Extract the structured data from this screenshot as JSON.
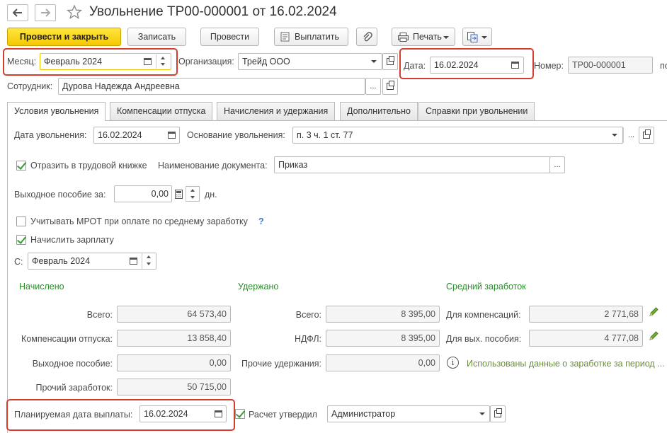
{
  "window": {
    "title": "Увольнение ТР00-000001 от 16.02.2024"
  },
  "toolbar": {
    "post_close": "Провести и закрыть",
    "save": "Записать",
    "post": "Провести",
    "pay": "Выплатить",
    "print": "Печать"
  },
  "header": {
    "month_label": "Месяц:",
    "month_value": "Февраль 2024",
    "org_label": "Организация:",
    "org_value": "Трейд ООО",
    "date_label": "Дата:",
    "date_value": "16.02.2024",
    "number_label": "Номер:",
    "number_value": "ТР00-000001",
    "number_suffix": "по",
    "employee_label": "Сотрудник:",
    "employee_value": "Дурова Надежда Андреевна"
  },
  "tabs": [
    {
      "label": "Условия увольнения"
    },
    {
      "label": "Компенсации отпуска"
    },
    {
      "label": "Начисления и удержания"
    },
    {
      "label": "Дополнительно"
    },
    {
      "label": "Справки при увольнении"
    }
  ],
  "form": {
    "dismissal_date_label": "Дата увольнения:",
    "dismissal_date_value": "16.02.2024",
    "basis_label": "Основание увольнения:",
    "basis_value": "п. 3 ч. 1 ст. 77",
    "workbook_label": "Отразить в трудовой книжке",
    "doc_name_label": "Наименование документа:",
    "doc_name_value": "Приказ",
    "severance_label": "Выходное пособие за:",
    "severance_value": "0,00",
    "severance_unit": "дн.",
    "mrot_label": "Учитывать МРОТ при оплате по среднему заработку",
    "mrot_help": "?",
    "accrue_label": "Начислить зарплату",
    "from_label": "С:",
    "from_value": "Февраль 2024"
  },
  "accrued": {
    "title": "Начислено",
    "total_label": "Всего:",
    "total_value": "64 573,40",
    "vacation_label": "Компенсации отпуска:",
    "vacation_value": "13 858,40",
    "severance_label": "Выходное пособие:",
    "severance_value": "0,00",
    "other_label": "Прочий заработок:",
    "other_value": "50 715,00"
  },
  "withheld": {
    "title": "Удержано",
    "total_label": "Всего:",
    "total_value": "8 395,00",
    "ndfl_label": "НДФЛ:",
    "ndfl_value": "8 395,00",
    "other_label": "Прочие удержания:",
    "other_value": "0,00"
  },
  "average": {
    "title": "Средний заработок",
    "comp_label": "Для компенсаций:",
    "comp_value": "2 771,68",
    "sev_label": "Для вых. пособия:",
    "sev_value": "4 777,08",
    "info_text": "Использованы данные о заработке за период ..."
  },
  "footer": {
    "planned_label": "Планируемая дата выплаты:",
    "planned_value": "16.02.2024",
    "approved_label": "Расчет утвердил",
    "approved_value": "Администратор"
  }
}
